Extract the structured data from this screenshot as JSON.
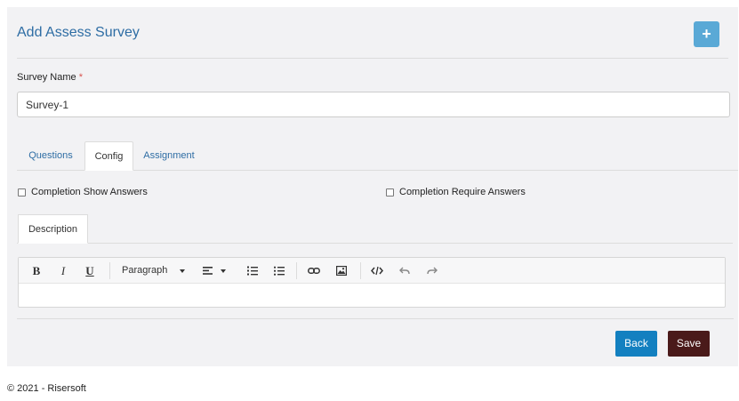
{
  "header": {
    "title": "Add Assess Survey",
    "add_label": "+"
  },
  "form": {
    "survey_name_label": "Survey Name",
    "required_mark": "*",
    "survey_name_value": "Survey-1"
  },
  "tabs": [
    {
      "label": "Questions"
    },
    {
      "label": "Config"
    },
    {
      "label": "Assignment"
    }
  ],
  "active_tab": "Config",
  "config": {
    "completion_show_answers": "Completion Show Answers",
    "completion_require_answers": "Completion Require Answers"
  },
  "description": {
    "tab_label": "Description",
    "toolbar": {
      "bold": "B",
      "italic": "I",
      "underline": "U",
      "paragraph": "Paragraph"
    }
  },
  "actions": {
    "back": "Back",
    "save": "Save"
  },
  "footer": {
    "text": "© 2021 - Risersoft"
  },
  "colors": {
    "back_button": "#1380c0",
    "save_button": "#4a1a1a",
    "link": "#2e6da4",
    "add_button": "#5aa9d6"
  }
}
